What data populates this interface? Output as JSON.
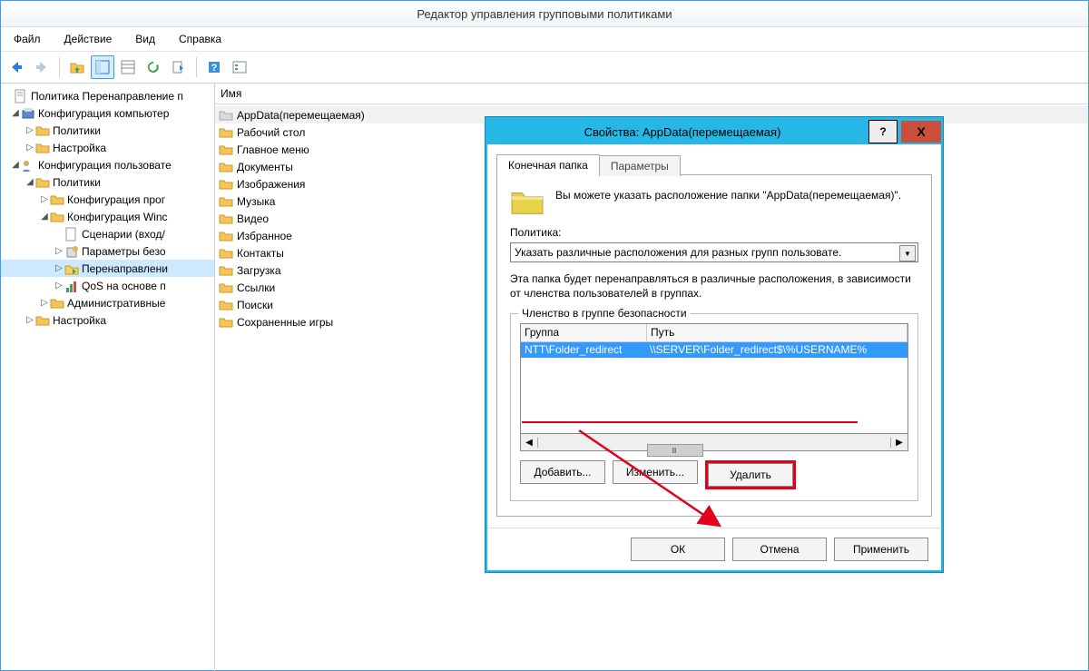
{
  "window_title": "Редактор управления групповыми политиками",
  "menu": {
    "file": "Файл",
    "action": "Действие",
    "view": "Вид",
    "help": "Справка"
  },
  "tree": {
    "root": "Политика Перенаправление п",
    "n1": "Конфигурация компьютер",
    "n1a": "Политики",
    "n1b": "Настройка",
    "n2": "Конфигурация пользовате",
    "n2a": "Политики",
    "n2a1": "Конфигурация прог",
    "n2a2": "Конфигурация Winc",
    "n2a2a": "Сценарии (вход/",
    "n2a2b": "Параметры безо",
    "n2a2c": "Перенаправлени",
    "n2a2d": "QoS на основе п",
    "n2a3": "Административные",
    "n2b": "Настройка"
  },
  "list_header": "Имя",
  "list_items": [
    "AppData(перемещаемая)",
    "Рабочий стол",
    "Главное меню",
    "Документы",
    "Изображения",
    "Музыка",
    "Видео",
    "Избранное",
    "Контакты",
    "Загрузка",
    "Ссылки",
    "Поиски",
    "Сохраненные игры"
  ],
  "dialog": {
    "title": "Свойства: AppData(перемещаемая)",
    "tab1": "Конечная папка",
    "tab2": "Параметры",
    "info": "Вы можете указать расположение папки \"AppData(перемещаемая)\".",
    "policy_label": "Политика:",
    "policy_value": "Указать различные расположения для разных групп пользовате.",
    "desc": "Эта папка будет перенаправляться в различные расположения, в зависимости от членства пользователей в группах.",
    "group_legend": "Членство в группе безопасности",
    "col_group": "Группа",
    "col_path": "Путь",
    "row_group": "NTT\\Folder_redirect",
    "row_path": "\\\\SERVER\\Folder_redirect$\\%USERNAME%",
    "btn_add": "Добавить...",
    "btn_edit": "Изменить...",
    "btn_del": "Удалить",
    "btn_ok": "ОК",
    "btn_cancel": "Отмена",
    "btn_apply": "Применить"
  }
}
